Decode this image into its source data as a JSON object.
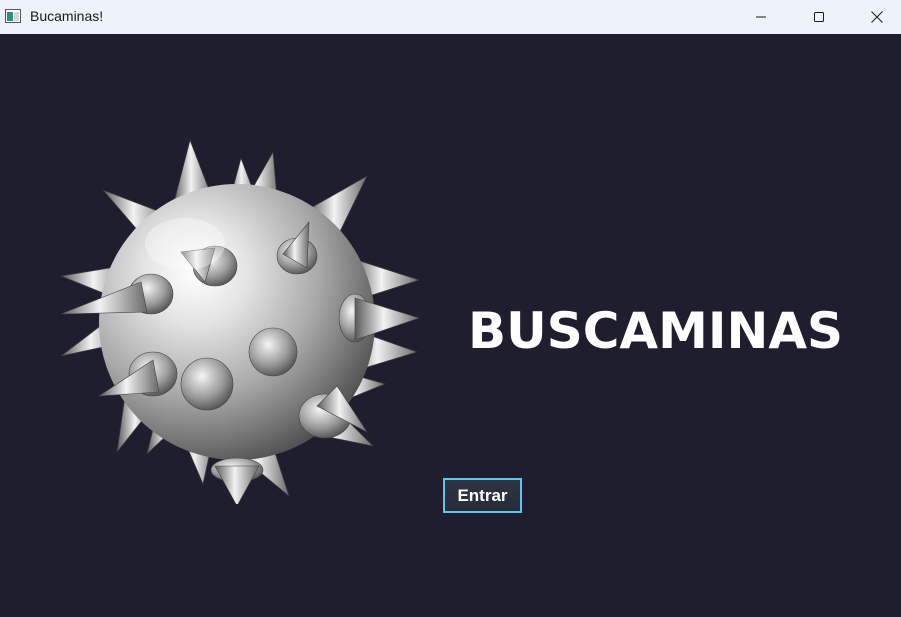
{
  "window": {
    "title": "Bucaminas!",
    "icon": "app-window-icon",
    "controls": [
      "minimize-icon",
      "maximize-icon",
      "close-icon"
    ]
  },
  "main": {
    "title": "BUSCAMINAS",
    "image": "mine-icon",
    "enter_button": "Entrar"
  },
  "colors": {
    "background": "#1f1e2e",
    "titlebar": "#eef3f9",
    "button_border": "#5cc8e8",
    "title_text": "#ffffff"
  }
}
